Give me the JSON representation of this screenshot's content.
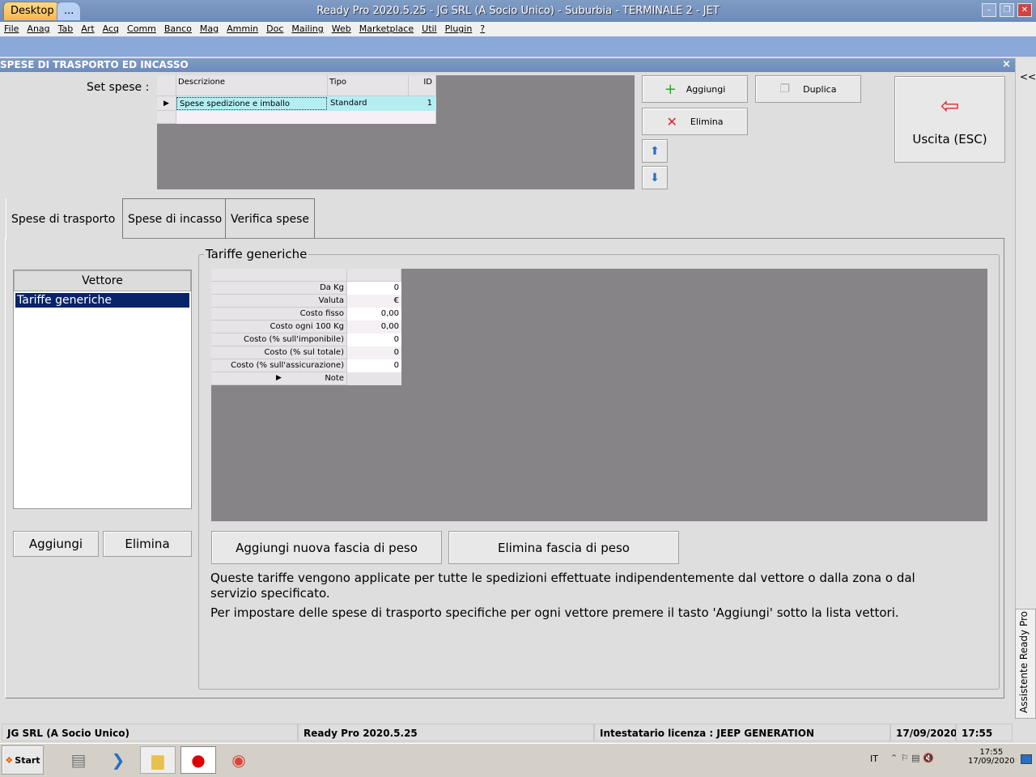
{
  "window": {
    "title": "Ready Pro 2020.5.25 - JG SRL (A Socio Unico) - Suburbia - TERMINALE 2 - JET",
    "app_icon": "strawberry-icon"
  },
  "menu": [
    "File",
    "Anag",
    "Tab",
    "Art",
    "Acq",
    "Comm",
    "Banco",
    "Mag",
    "Ammin",
    "Doc",
    "Mailing",
    "Web",
    "Marketplace",
    "Util",
    "Plugin",
    "?"
  ],
  "desktop_tabs": [
    "Desktop",
    "..."
  ],
  "form": {
    "title": "SPESE DI TRASPORTO ED INCASSO",
    "close": "×",
    "collapse": "<<"
  },
  "set_spese": {
    "label": "Set spese :",
    "columns": [
      "Descrizione",
      "Tipo",
      "ID"
    ],
    "rows": [
      {
        "descrizione": "Spese spedizione e imballo",
        "tipo": "Standard",
        "id": "1"
      }
    ]
  },
  "buttons": {
    "aggiungi": "Aggiungi",
    "duplica": "Duplica",
    "elimina": "Elimina",
    "uscita": "Uscita (ESC)",
    "aggiungi_vettore": "Aggiungi",
    "elimina_vettore": "Elimina",
    "aggiungi_fascia": "Aggiungi nuova fascia di peso",
    "elimina_fascia": "Elimina fascia di peso"
  },
  "tabs": [
    "Spese di trasporto",
    "Spese di incasso",
    "Verifica spese"
  ],
  "vettore": {
    "header": "Vettore",
    "items": [
      "Tariffe generiche"
    ]
  },
  "tariffe": {
    "title": "Tariffe generiche",
    "rows": [
      {
        "label": "Da Kg",
        "value": "0"
      },
      {
        "label": "Valuta",
        "value": "€"
      },
      {
        "label": "Costo fisso",
        "value": "0,00"
      },
      {
        "label": "Costo ogni 100 Kg",
        "value": "0,00"
      },
      {
        "label": "Costo (% sull'imponibile)",
        "value": "0"
      },
      {
        "label": "Costo (% sul totale)",
        "value": "0"
      },
      {
        "label": "Costo (% sull'assicurazione)",
        "value": "0"
      },
      {
        "label": "Note",
        "value": ""
      }
    ]
  },
  "info": {
    "line1": "Queste tariffe vengono applicate per tutte le spedizioni effettuate indipendentemente dal vettore o dalla zona o dal",
    "line2": "servizio specificato.",
    "line3": "Per impostare delle spese di trasporto specifiche per ogni vettore premere il tasto 'Aggiungi' sotto la lista vettori."
  },
  "side_panel": "Assistente Ready Pro",
  "status": {
    "company": "JG SRL (A Socio Unico)",
    "version": "Ready Pro 2020.5.25",
    "license": "Intestatario licenza : JEEP GENERATION",
    "date": "17/09/2020",
    "time": "17:55"
  },
  "taskbar": {
    "start": "Start",
    "lang": "IT",
    "time": "17:55",
    "date": "17/09/2020"
  }
}
